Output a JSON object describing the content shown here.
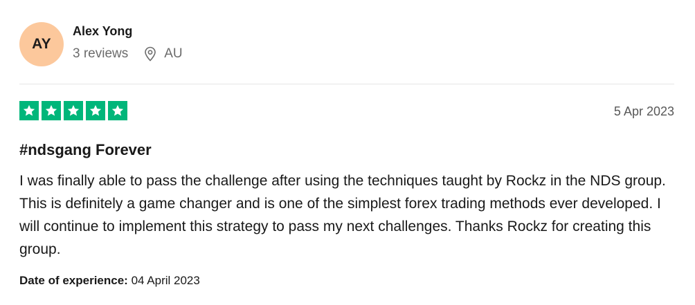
{
  "reviewer": {
    "initials": "AY",
    "name": "Alex Yong",
    "reviews_count": "3 reviews",
    "location": "AU",
    "location_icon": "location-pin-icon"
  },
  "review": {
    "rating": 5,
    "rating_max": 5,
    "star_icon": "star-icon",
    "date": "5 Apr 2023",
    "title": "#ndsgang Forever",
    "body": "I was finally able to pass the challenge after using the techniques taught by Rockz in the NDS group. This is definitely a game changer and is one of the simplest forex trading methods ever developed. I will continue to implement this strategy to pass my next challenges. Thanks Rockz for creating this group.",
    "experience_label": "Date of experience:",
    "experience_date": "04 April 2023"
  },
  "colors": {
    "avatar_bg": "#fcc89c",
    "star_bg": "#00b67a",
    "star_fg": "#ffffff",
    "text_primary": "#191919",
    "text_secondary": "#6b6b6b",
    "divider": "#e5e5e5"
  }
}
